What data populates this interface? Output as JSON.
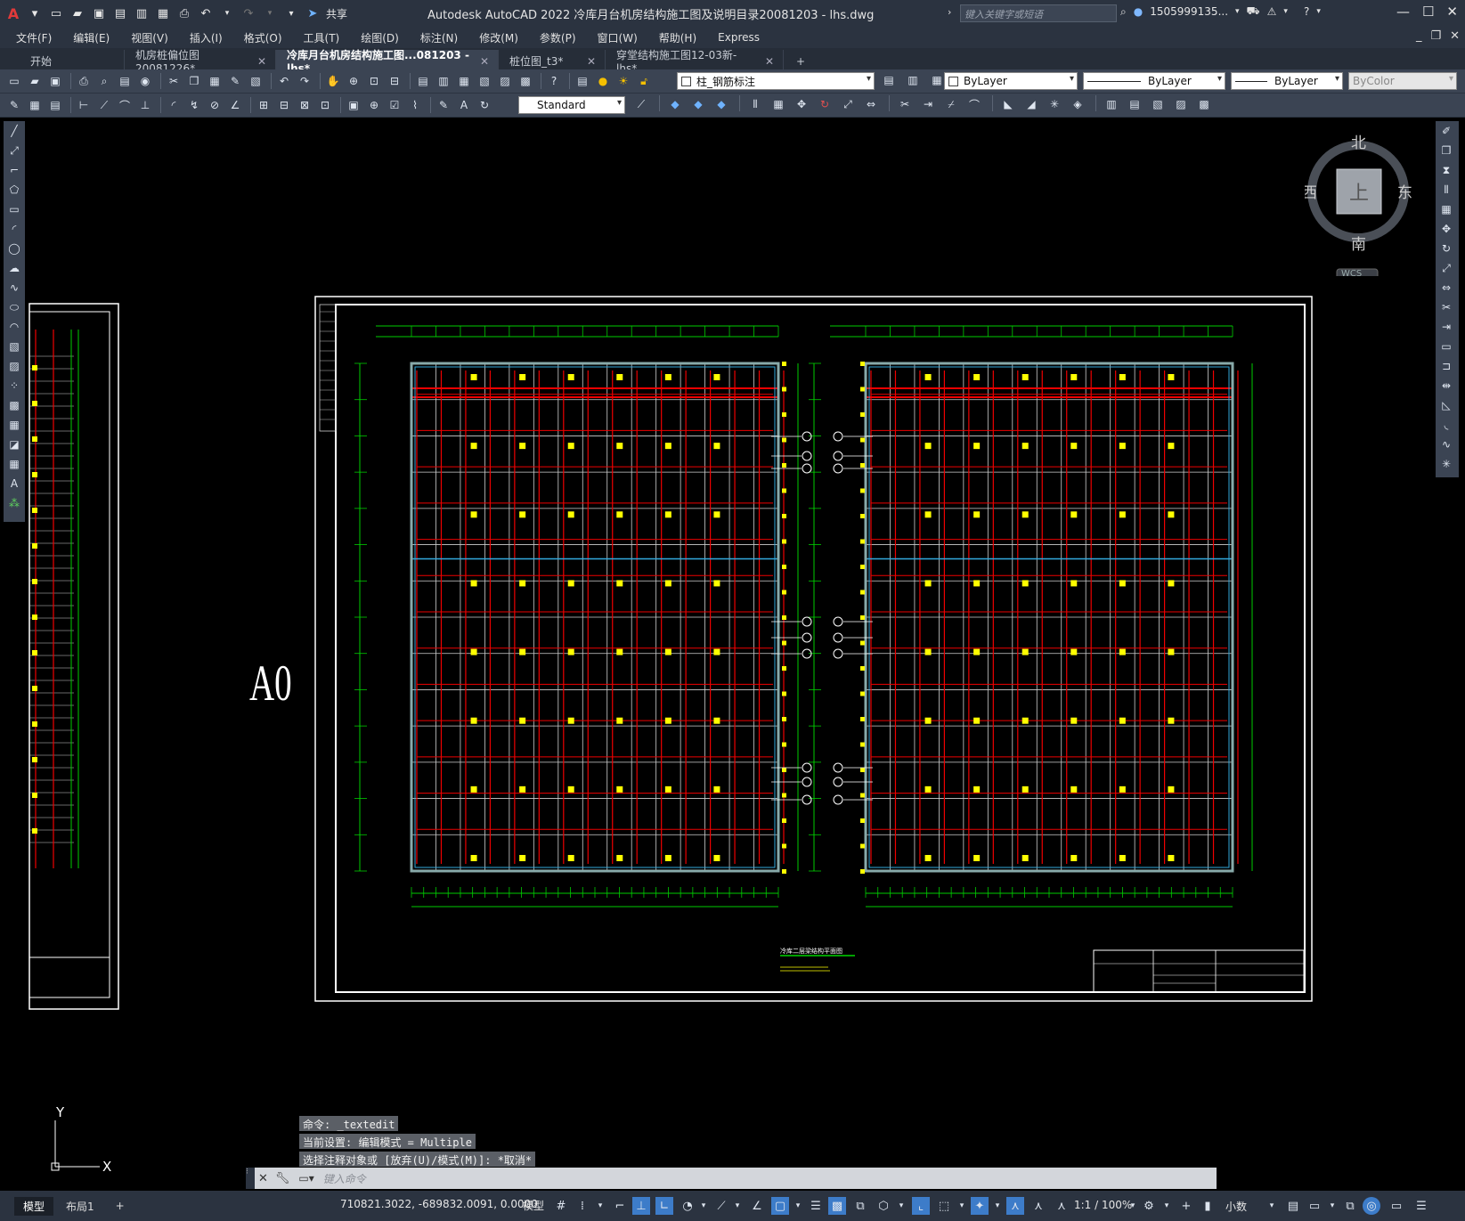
{
  "app": {
    "title": "Autodesk AutoCAD 2022    冷库月台机房结构施工图及说明目录20081203 - lhs.dwg",
    "share_label": "共享",
    "search_placeholder": "键入关键字或短语",
    "user": "1505999135...",
    "accent_color": "#c8102e"
  },
  "menu": [
    "文件(F)",
    "编辑(E)",
    "视图(V)",
    "插入(I)",
    "格式(O)",
    "工具(T)",
    "绘图(D)",
    "标注(N)",
    "修改(M)",
    "参数(P)",
    "窗口(W)",
    "帮助(H)",
    "Express"
  ],
  "tabs": [
    {
      "label": "开始",
      "closable": false,
      "active": false
    },
    {
      "label": "机房桩偏位图20081226*",
      "closable": true,
      "active": false
    },
    {
      "label": "冷库月台机房结构施工图...081203 - lhs*",
      "closable": true,
      "active": true
    },
    {
      "label": "桩位图_t3*",
      "closable": true,
      "active": false
    },
    {
      "label": "穿堂结构施工图12-03新-lhs*",
      "closable": true,
      "active": false
    }
  ],
  "add_tab_label": "+",
  "layer_combo": "柱_钢筋标注",
  "color_combo": "ByLayer",
  "linetype_combo": "ByLayer",
  "lineweight_combo": "ByLayer",
  "plotstyle_combo": "ByColor",
  "text_style_combo": "Standard",
  "viewcube": {
    "north": "北",
    "south": "南",
    "east": "东",
    "west": "西",
    "top": "上",
    "wcs": "WCS"
  },
  "drawing": {
    "sheet_label": "A0",
    "plan_title": "冷库二层梁结构平面图",
    "ucs_x": "X",
    "ucs_y": "Y"
  },
  "command_history": [
    "命令: _textedit",
    "当前设置: 编辑模式 = Multiple",
    "选择注释对象或 [放弃(U)/模式(M)]: *取消*"
  ],
  "command_placeholder": "键入命令",
  "status": {
    "layout_tabs": [
      "模型",
      "布局1"
    ],
    "add_layout": "+",
    "coordinates": "710821.3022, -689832.0091, 0.0000",
    "model_label": "模型",
    "scale": "1:1 / 100%",
    "units": "小数"
  }
}
